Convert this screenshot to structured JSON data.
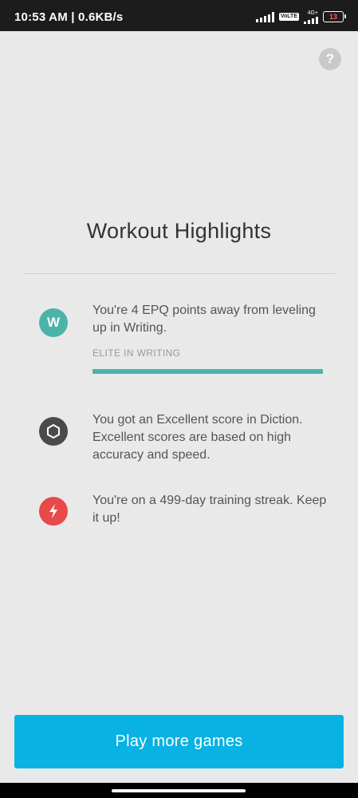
{
  "status_bar": {
    "time": "10:53 AM | 0.6KB/s",
    "volte_label": "VoLTE",
    "network_label": "4G+",
    "battery_level": "13"
  },
  "header": {
    "help_icon": "question-icon",
    "help_label": "?"
  },
  "main": {
    "title": "Workout Highlights",
    "highlights": [
      {
        "icon": "writing-badge-icon",
        "icon_letter": "W",
        "color": "#4cb3a9",
        "text": "You're 4 EPQ points away from leveling up in Writing.",
        "subtitle": "ELITE IN WRITING",
        "progress": 1.0
      },
      {
        "icon": "hexagon-icon",
        "color": "#4a4a4a",
        "text": "You got an Excellent score in Diction. Excellent scores are based on high accuracy and speed."
      },
      {
        "icon": "lightning-icon",
        "color": "#e84a4a",
        "text": "You're on a 499-day training streak. Keep it up!"
      }
    ]
  },
  "footer": {
    "play_button_label": "Play more games",
    "accent_color": "#08b2e3"
  }
}
